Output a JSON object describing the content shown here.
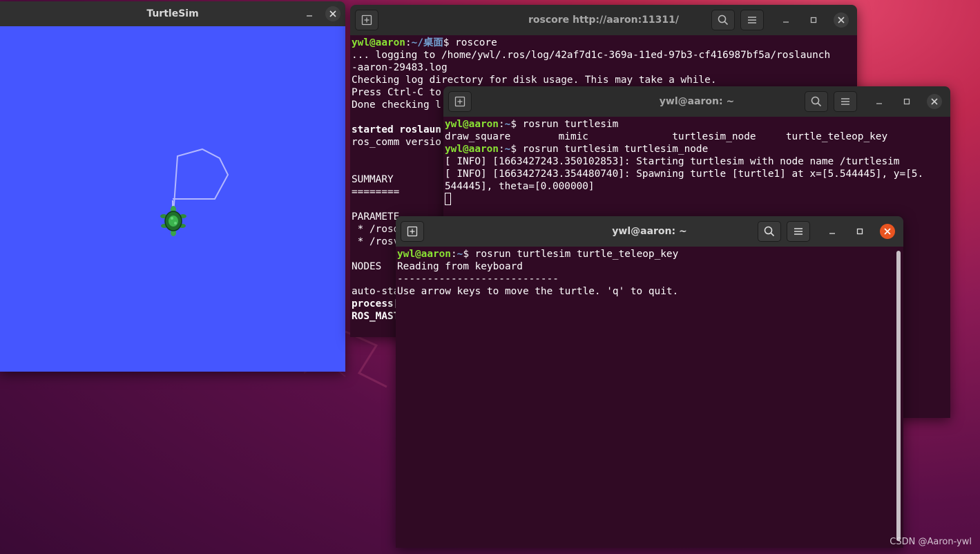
{
  "turtlesim": {
    "title": "TurtleSim",
    "background_color": "#4556ff",
    "path_color": "#b3b8ff"
  },
  "roscore_window": {
    "title": "roscore http://aaron:11311/",
    "lines": [
      [
        {
          "t": "ywl@aaron",
          "c": "g"
        },
        {
          "t": ":",
          "c": ""
        },
        {
          "t": "~/桌面",
          "c": "b"
        },
        {
          "t": "$ roscore",
          "c": ""
        }
      ],
      [
        {
          "t": "... logging to /home/ywl/.ros/log/42af7d1c-369a-11ed-97b3-cf416987bf5a/roslaunch",
          "c": ""
        }
      ],
      [
        {
          "t": "-aaron-29483.log",
          "c": ""
        }
      ],
      [
        {
          "t": "Checking log directory for disk usage. This may take a while.",
          "c": ""
        }
      ],
      [
        {
          "t": "Press Ctrl-C to",
          "c": ""
        }
      ],
      [
        {
          "t": "Done checking l",
          "c": ""
        }
      ],
      [
        {
          "t": "",
          "c": ""
        }
      ],
      [
        {
          "t": "started roslaun",
          "c": "bold"
        }
      ],
      [
        {
          "t": "ros_comm versio",
          "c": ""
        }
      ],
      [
        {
          "t": "",
          "c": ""
        }
      ],
      [
        {
          "t": "",
          "c": ""
        }
      ],
      [
        {
          "t": "SUMMARY",
          "c": ""
        }
      ],
      [
        {
          "t": "========",
          "c": ""
        }
      ],
      [
        {
          "t": "",
          "c": ""
        }
      ],
      [
        {
          "t": "PARAMETE",
          "c": ""
        }
      ],
      [
        {
          "t": " * /rosd",
          "c": ""
        }
      ],
      [
        {
          "t": " * /rosv",
          "c": ""
        }
      ],
      [
        {
          "t": "",
          "c": ""
        }
      ],
      [
        {
          "t": "NODES",
          "c": ""
        }
      ],
      [
        {
          "t": "",
          "c": ""
        }
      ],
      [
        {
          "t": "auto-sta",
          "c": ""
        }
      ],
      [
        {
          "t": "process[",
          "c": "bold"
        }
      ],
      [
        {
          "t": "ROS_MAST",
          "c": "bold"
        }
      ]
    ]
  },
  "turtlesim_node_window": {
    "title": "ywl@aaron: ~",
    "lines": [
      [
        {
          "t": "ywl@aaron",
          "c": "g"
        },
        {
          "t": ":",
          "c": ""
        },
        {
          "t": "~",
          "c": "b"
        },
        {
          "t": "$ rosrun turtlesim",
          "c": ""
        }
      ],
      [
        {
          "t": "draw_square        mimic              turtlesim_node     turtle_teleop_key",
          "c": ""
        }
      ],
      [
        {
          "t": "ywl@aaron",
          "c": "g"
        },
        {
          "t": ":",
          "c": ""
        },
        {
          "t": "~",
          "c": "b"
        },
        {
          "t": "$ rosrun turtlesim turtlesim_node",
          "c": ""
        }
      ],
      [
        {
          "t": "[ INFO] [1663427243.350102853]: Starting turtlesim with node name /turtlesim",
          "c": ""
        }
      ],
      [
        {
          "t": "[ INFO] [1663427243.354480740]: Spawning turtle [turtle1] at x=[5.544445], y=[5.",
          "c": ""
        }
      ],
      [
        {
          "t": "544445], theta=[0.000000]",
          "c": ""
        }
      ]
    ]
  },
  "teleop_window": {
    "title": "ywl@aaron: ~",
    "lines": [
      [
        {
          "t": "ywl@aaron",
          "c": "g"
        },
        {
          "t": ":",
          "c": ""
        },
        {
          "t": "~",
          "c": "b"
        },
        {
          "t": "$ rosrun turtlesim turtle_teleop_key",
          "c": ""
        }
      ],
      [
        {
          "t": "Reading from keyboard",
          "c": ""
        }
      ],
      [
        {
          "t": "---------------------------",
          "c": ""
        }
      ],
      [
        {
          "t": "Use arrow keys to move the turtle. 'q' to quit.",
          "c": ""
        }
      ]
    ]
  },
  "icons": {
    "new_tab": "new-tab-icon",
    "search": "search-icon",
    "menu": "hamburger-menu-icon",
    "minimize": "minimize-icon",
    "maximize": "maximize-icon",
    "close": "close-icon",
    "turtle": "turtle-icon"
  },
  "colors": {
    "terminal_bg": "#300a24",
    "prompt_user": "#8ae234",
    "prompt_path": "#729fcf",
    "close_active": "#e95420"
  },
  "watermark": "CSDN @Aaron-ywl"
}
